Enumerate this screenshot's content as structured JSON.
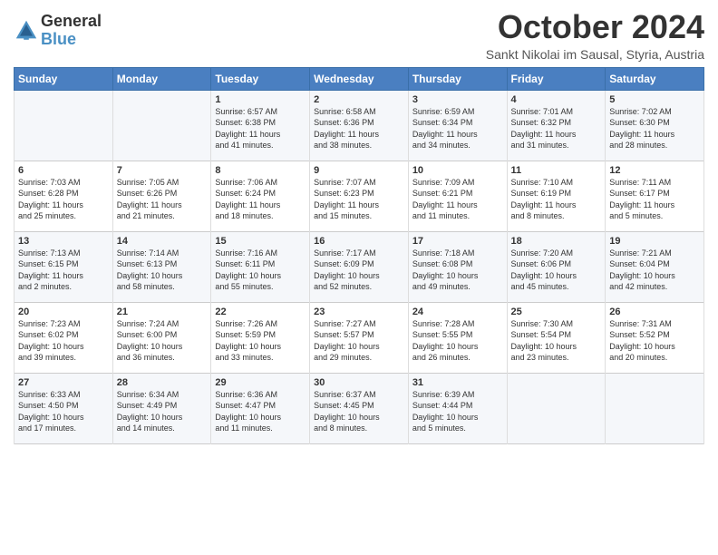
{
  "header": {
    "logo_line1": "General",
    "logo_line2": "Blue",
    "month": "October 2024",
    "location": "Sankt Nikolai im Sausal, Styria, Austria"
  },
  "days_of_week": [
    "Sunday",
    "Monday",
    "Tuesday",
    "Wednesday",
    "Thursday",
    "Friday",
    "Saturday"
  ],
  "weeks": [
    [
      {
        "day": "",
        "info": ""
      },
      {
        "day": "",
        "info": ""
      },
      {
        "day": "1",
        "info": "Sunrise: 6:57 AM\nSunset: 6:38 PM\nDaylight: 11 hours\nand 41 minutes."
      },
      {
        "day": "2",
        "info": "Sunrise: 6:58 AM\nSunset: 6:36 PM\nDaylight: 11 hours\nand 38 minutes."
      },
      {
        "day": "3",
        "info": "Sunrise: 6:59 AM\nSunset: 6:34 PM\nDaylight: 11 hours\nand 34 minutes."
      },
      {
        "day": "4",
        "info": "Sunrise: 7:01 AM\nSunset: 6:32 PM\nDaylight: 11 hours\nand 31 minutes."
      },
      {
        "day": "5",
        "info": "Sunrise: 7:02 AM\nSunset: 6:30 PM\nDaylight: 11 hours\nand 28 minutes."
      }
    ],
    [
      {
        "day": "6",
        "info": "Sunrise: 7:03 AM\nSunset: 6:28 PM\nDaylight: 11 hours\nand 25 minutes."
      },
      {
        "day": "7",
        "info": "Sunrise: 7:05 AM\nSunset: 6:26 PM\nDaylight: 11 hours\nand 21 minutes."
      },
      {
        "day": "8",
        "info": "Sunrise: 7:06 AM\nSunset: 6:24 PM\nDaylight: 11 hours\nand 18 minutes."
      },
      {
        "day": "9",
        "info": "Sunrise: 7:07 AM\nSunset: 6:23 PM\nDaylight: 11 hours\nand 15 minutes."
      },
      {
        "day": "10",
        "info": "Sunrise: 7:09 AM\nSunset: 6:21 PM\nDaylight: 11 hours\nand 11 minutes."
      },
      {
        "day": "11",
        "info": "Sunrise: 7:10 AM\nSunset: 6:19 PM\nDaylight: 11 hours\nand 8 minutes."
      },
      {
        "day": "12",
        "info": "Sunrise: 7:11 AM\nSunset: 6:17 PM\nDaylight: 11 hours\nand 5 minutes."
      }
    ],
    [
      {
        "day": "13",
        "info": "Sunrise: 7:13 AM\nSunset: 6:15 PM\nDaylight: 11 hours\nand 2 minutes."
      },
      {
        "day": "14",
        "info": "Sunrise: 7:14 AM\nSunset: 6:13 PM\nDaylight: 10 hours\nand 58 minutes."
      },
      {
        "day": "15",
        "info": "Sunrise: 7:16 AM\nSunset: 6:11 PM\nDaylight: 10 hours\nand 55 minutes."
      },
      {
        "day": "16",
        "info": "Sunrise: 7:17 AM\nSunset: 6:09 PM\nDaylight: 10 hours\nand 52 minutes."
      },
      {
        "day": "17",
        "info": "Sunrise: 7:18 AM\nSunset: 6:08 PM\nDaylight: 10 hours\nand 49 minutes."
      },
      {
        "day": "18",
        "info": "Sunrise: 7:20 AM\nSunset: 6:06 PM\nDaylight: 10 hours\nand 45 minutes."
      },
      {
        "day": "19",
        "info": "Sunrise: 7:21 AM\nSunset: 6:04 PM\nDaylight: 10 hours\nand 42 minutes."
      }
    ],
    [
      {
        "day": "20",
        "info": "Sunrise: 7:23 AM\nSunset: 6:02 PM\nDaylight: 10 hours\nand 39 minutes."
      },
      {
        "day": "21",
        "info": "Sunrise: 7:24 AM\nSunset: 6:00 PM\nDaylight: 10 hours\nand 36 minutes."
      },
      {
        "day": "22",
        "info": "Sunrise: 7:26 AM\nSunset: 5:59 PM\nDaylight: 10 hours\nand 33 minutes."
      },
      {
        "day": "23",
        "info": "Sunrise: 7:27 AM\nSunset: 5:57 PM\nDaylight: 10 hours\nand 29 minutes."
      },
      {
        "day": "24",
        "info": "Sunrise: 7:28 AM\nSunset: 5:55 PM\nDaylight: 10 hours\nand 26 minutes."
      },
      {
        "day": "25",
        "info": "Sunrise: 7:30 AM\nSunset: 5:54 PM\nDaylight: 10 hours\nand 23 minutes."
      },
      {
        "day": "26",
        "info": "Sunrise: 7:31 AM\nSunset: 5:52 PM\nDaylight: 10 hours\nand 20 minutes."
      }
    ],
    [
      {
        "day": "27",
        "info": "Sunrise: 6:33 AM\nSunset: 4:50 PM\nDaylight: 10 hours\nand 17 minutes."
      },
      {
        "day": "28",
        "info": "Sunrise: 6:34 AM\nSunset: 4:49 PM\nDaylight: 10 hours\nand 14 minutes."
      },
      {
        "day": "29",
        "info": "Sunrise: 6:36 AM\nSunset: 4:47 PM\nDaylight: 10 hours\nand 11 minutes."
      },
      {
        "day": "30",
        "info": "Sunrise: 6:37 AM\nSunset: 4:45 PM\nDaylight: 10 hours\nand 8 minutes."
      },
      {
        "day": "31",
        "info": "Sunrise: 6:39 AM\nSunset: 4:44 PM\nDaylight: 10 hours\nand 5 minutes."
      },
      {
        "day": "",
        "info": ""
      },
      {
        "day": "",
        "info": ""
      }
    ]
  ]
}
